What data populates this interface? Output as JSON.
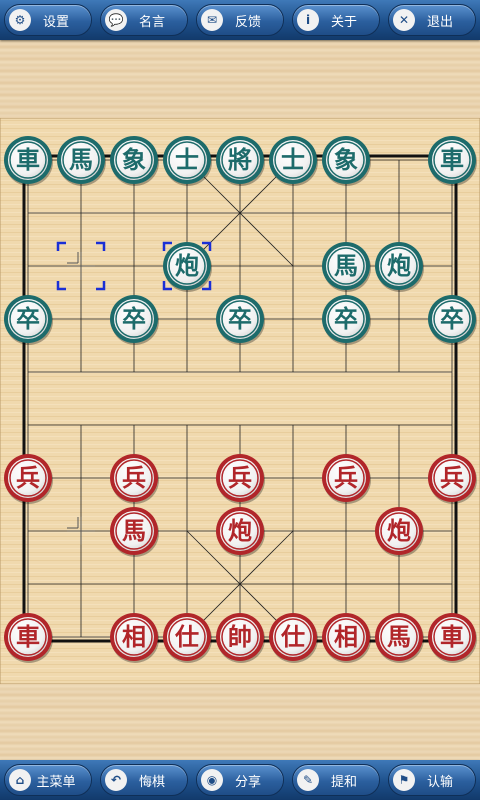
{
  "top_menu": [
    {
      "label": "设置",
      "icon": "gear-icon"
    },
    {
      "label": "名言",
      "icon": "speech-bubble-icon"
    },
    {
      "label": "反馈",
      "icon": "envelope-icon"
    },
    {
      "label": "关于",
      "icon": "info-icon"
    },
    {
      "label": "退出",
      "icon": "close-icon"
    }
  ],
  "bottom_menu": [
    {
      "label": "主菜单",
      "icon": "home-icon"
    },
    {
      "label": "悔棋",
      "icon": "undo-icon"
    },
    {
      "label": "分享",
      "icon": "share-icon"
    },
    {
      "label": "提和",
      "icon": "pencil-icon"
    },
    {
      "label": "认输",
      "icon": "flag-icon"
    }
  ],
  "colors": {
    "black_side": "#1d6b6b",
    "red_side": "#b1262a",
    "selection": "#1a2fd6"
  },
  "pieces": [
    {
      "side": "black",
      "char": "車",
      "col": 0,
      "row": 0
    },
    {
      "side": "black",
      "char": "馬",
      "col": 1,
      "row": 0
    },
    {
      "side": "black",
      "char": "象",
      "col": 2,
      "row": 0
    },
    {
      "side": "black",
      "char": "士",
      "col": 3,
      "row": 0
    },
    {
      "side": "black",
      "char": "將",
      "col": 4,
      "row": 0
    },
    {
      "side": "black",
      "char": "士",
      "col": 5,
      "row": 0
    },
    {
      "side": "black",
      "char": "象",
      "col": 6,
      "row": 0
    },
    {
      "side": "black",
      "char": "車",
      "col": 8,
      "row": 0
    },
    {
      "side": "black",
      "char": "炮",
      "col": 3,
      "row": 2,
      "selected": true
    },
    {
      "side": "black",
      "char": "馬",
      "col": 6,
      "row": 2
    },
    {
      "side": "black",
      "char": "炮",
      "col": 7,
      "row": 2
    },
    {
      "side": "black",
      "char": "卒",
      "col": 0,
      "row": 3
    },
    {
      "side": "black",
      "char": "卒",
      "col": 2,
      "row": 3
    },
    {
      "side": "black",
      "char": "卒",
      "col": 4,
      "row": 3
    },
    {
      "side": "black",
      "char": "卒",
      "col": 6,
      "row": 3
    },
    {
      "side": "black",
      "char": "卒",
      "col": 8,
      "row": 3
    },
    {
      "side": "red",
      "char": "兵",
      "col": 0,
      "row": 6
    },
    {
      "side": "red",
      "char": "兵",
      "col": 2,
      "row": 6
    },
    {
      "side": "red",
      "char": "兵",
      "col": 4,
      "row": 6
    },
    {
      "side": "red",
      "char": "兵",
      "col": 6,
      "row": 6
    },
    {
      "side": "red",
      "char": "兵",
      "col": 8,
      "row": 6
    },
    {
      "side": "red",
      "char": "馬",
      "col": 2,
      "row": 7
    },
    {
      "side": "red",
      "char": "炮",
      "col": 4,
      "row": 7
    },
    {
      "side": "red",
      "char": "炮",
      "col": 7,
      "row": 7
    },
    {
      "side": "red",
      "char": "車",
      "col": 0,
      "row": 9
    },
    {
      "side": "red",
      "char": "相",
      "col": 2,
      "row": 9
    },
    {
      "side": "red",
      "char": "仕",
      "col": 3,
      "row": 9
    },
    {
      "side": "red",
      "char": "帥",
      "col": 4,
      "row": 9
    },
    {
      "side": "red",
      "char": "仕",
      "col": 5,
      "row": 9
    },
    {
      "side": "red",
      "char": "相",
      "col": 6,
      "row": 9
    },
    {
      "side": "red",
      "char": "馬",
      "col": 7,
      "row": 9
    },
    {
      "side": "red",
      "char": "車",
      "col": 8,
      "row": 9
    }
  ],
  "move_origin": {
    "col": 1,
    "row": 2
  },
  "position_markers": [
    {
      "col": 1,
      "row": 7
    }
  ]
}
